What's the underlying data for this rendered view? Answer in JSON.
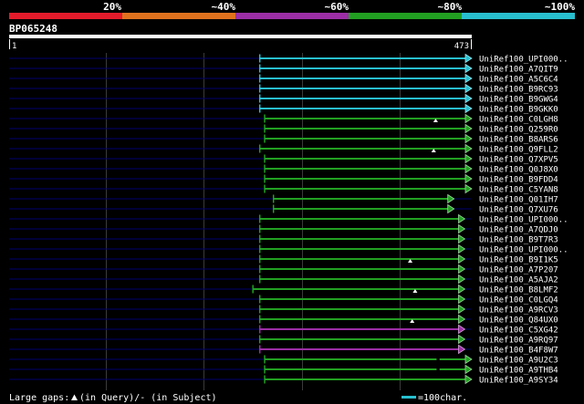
{
  "chart_data": {
    "type": "bar",
    "query": "BP065248",
    "x_range": [
      1,
      473
    ],
    "x_gridlines": [
      100,
      200,
      300,
      400
    ],
    "color_key": [
      {
        "label": "20%",
        "color": "#e41b2b"
      },
      {
        "label": "~40%",
        "color": "#e0721e"
      },
      {
        "label": "~60%",
        "color": "#9c2ea6"
      },
      {
        "label": "~80%",
        "color": "#22a022"
      },
      {
        "label": "~100%",
        "color": "#28bfcf"
      }
    ],
    "hits": [
      {
        "name": "UniRef100_UPI000..",
        "start": 257,
        "end": 473,
        "color": "#28bfcf"
      },
      {
        "name": "UniRef100_A7QIT9",
        "start": 257,
        "end": 473,
        "color": "#28bfcf"
      },
      {
        "name": "UniRef100_A5C6C4",
        "start": 257,
        "end": 473,
        "color": "#28bfcf"
      },
      {
        "name": "UniRef100_B9RC93",
        "start": 257,
        "end": 473,
        "color": "#28bfcf"
      },
      {
        "name": "UniRef100_B9GWG4",
        "start": 257,
        "end": 473,
        "color": "#28bfcf"
      },
      {
        "name": "UniRef100_B9GKK0",
        "start": 257,
        "end": 473,
        "color": "#28bfcf"
      },
      {
        "name": "UniRef100_C0LGH8",
        "start": 262,
        "end": 473,
        "color": "#22a022",
        "query_gaps": [
          437
        ]
      },
      {
        "name": "UniRef100_Q259R0",
        "start": 262,
        "end": 473,
        "color": "#22a022"
      },
      {
        "name": "UniRef100_B8ARS6",
        "start": 262,
        "end": 473,
        "color": "#22a022"
      },
      {
        "name": "UniRef100_Q9FLL2",
        "start": 257,
        "end": 473,
        "color": "#22a022",
        "query_gaps": [
          435
        ]
      },
      {
        "name": "UniRef100_Q7XPV5",
        "start": 262,
        "end": 473,
        "color": "#22a022"
      },
      {
        "name": "UniRef100_Q0J8X0",
        "start": 262,
        "end": 473,
        "color": "#22a022"
      },
      {
        "name": "UniRef100_B9FDD4",
        "start": 262,
        "end": 473,
        "color": "#22a022"
      },
      {
        "name": "UniRef100_C5YAN8",
        "start": 262,
        "end": 473,
        "color": "#22a022"
      },
      {
        "name": "UniRef100_Q01IH7",
        "start": 271,
        "end": 455,
        "color": "#22a022"
      },
      {
        "name": "UniRef100_Q7XU76",
        "start": 271,
        "end": 455,
        "color": "#22a022"
      },
      {
        "name": "UniRef100_UPI000..",
        "start": 257,
        "end": 466,
        "color": "#22a022"
      },
      {
        "name": "UniRef100_A7QDJ0",
        "start": 257,
        "end": 466,
        "color": "#22a022"
      },
      {
        "name": "UniRef100_B9T7R3",
        "start": 257,
        "end": 466,
        "color": "#22a022"
      },
      {
        "name": "UniRef100_UPI000..",
        "start": 257,
        "end": 466,
        "color": "#22a022"
      },
      {
        "name": "UniRef100_B9I1K5",
        "start": 257,
        "end": 466,
        "color": "#22a022",
        "query_gaps": [
          411
        ]
      },
      {
        "name": "UniRef100_A7P207",
        "start": 257,
        "end": 466,
        "color": "#22a022"
      },
      {
        "name": "UniRef100_A5AJA2",
        "start": 257,
        "end": 466,
        "color": "#22a022"
      },
      {
        "name": "UniRef100_B8LMF2",
        "start": 250,
        "end": 466,
        "color": "#22a022",
        "query_gaps": [
          416
        ]
      },
      {
        "name": "UniRef100_C0LGQ4",
        "start": 257,
        "end": 466,
        "color": "#22a022"
      },
      {
        "name": "UniRef100_A9RCV3",
        "start": 257,
        "end": 466,
        "color": "#22a022"
      },
      {
        "name": "UniRef100_Q84UX0",
        "start": 257,
        "end": 466,
        "color": "#22a022",
        "query_gaps": [
          413
        ]
      },
      {
        "name": "UniRef100_C5XG42",
        "start": 257,
        "end": 466,
        "color": "#9c2ea6"
      },
      {
        "name": "UniRef100_A9RQ97",
        "start": 257,
        "end": 466,
        "color": "#22a022"
      },
      {
        "name": "UniRef100_B4F8W7",
        "start": 257,
        "end": 466,
        "color": "#9c2ea6"
      },
      {
        "name": "UniRef100_A9U2C3",
        "start": 262,
        "end": 473,
        "color": "#22a022",
        "subject_gaps": [
          [
            438,
            441
          ]
        ]
      },
      {
        "name": "UniRef100_A9THB4",
        "start": 262,
        "end": 473,
        "color": "#22a022",
        "subject_gaps": [
          [
            438,
            441
          ]
        ]
      },
      {
        "name": "UniRef100_A9SY34",
        "start": 262,
        "end": 473,
        "color": "#22a022"
      }
    ],
    "legend": {
      "large_gaps": "Large gaps:",
      "gap_note": "(in Query)/- (in Subject)",
      "scale_note": "=100char.",
      "scale_color": "#28bfcf"
    }
  }
}
